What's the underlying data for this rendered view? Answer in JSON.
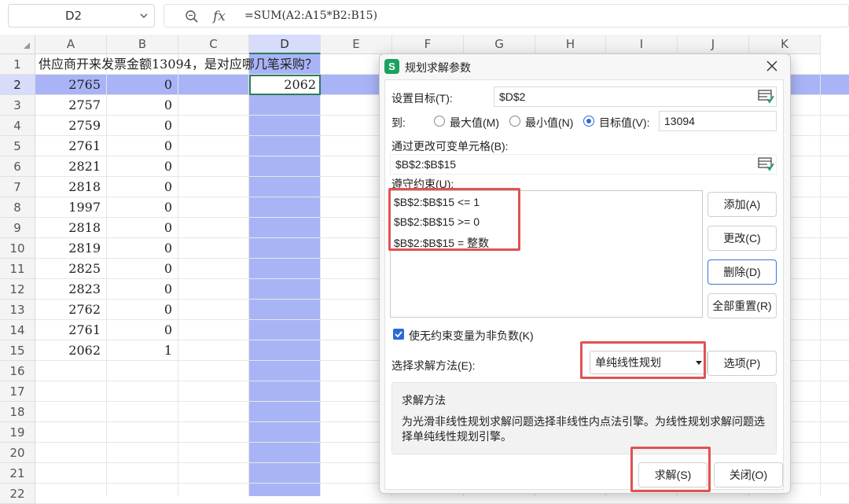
{
  "formula_bar": {
    "name_box": "D2",
    "zoom_icon": "zoom-icon",
    "fx_icon": "fx",
    "formula": "=SUM(A2:A15*B2:B15)"
  },
  "grid": {
    "columns": [
      "A",
      "B",
      "C",
      "D",
      "E",
      "F",
      "G",
      "H",
      "I",
      "J",
      "K"
    ],
    "selected_column": "D",
    "rows": [
      "1",
      "2",
      "3",
      "4",
      "5",
      "6",
      "7",
      "8",
      "9",
      "10",
      "11",
      "12",
      "13",
      "14",
      "15",
      "16",
      "17",
      "18",
      "19",
      "20",
      "21",
      "22"
    ],
    "selected_row": "2",
    "title_text": "供应商开来发票金额13094，是对应哪几笔采购？",
    "col_a": [
      "2765",
      "2757",
      "2759",
      "2761",
      "2821",
      "2818",
      "1997",
      "2818",
      "2819",
      "2825",
      "2823",
      "2762",
      "2761",
      "2062"
    ],
    "col_b": [
      "0",
      "0",
      "0",
      "0",
      "0",
      "0",
      "0",
      "0",
      "0",
      "0",
      "0",
      "0",
      "0",
      "1"
    ],
    "d2_value": "2062",
    "highlight_color": "#a9b4f7",
    "active_border_color": "#2b7d5a"
  },
  "dialog": {
    "title": "规划求解参数",
    "logo_letter": "S",
    "set_objective_label": "设置目标(T):",
    "set_objective_value": "$D$2",
    "to_label": "到:",
    "max_label": "最大值(M)",
    "min_label": "最小值(N)",
    "value_of_label": "目标值(V):",
    "value_of_value": "13094",
    "selected_goal": "目标值",
    "changing_cells_label": "通过更改可变单元格(B):",
    "changing_cells_value": "$B$2:$B$15",
    "constraints_label": "遵守约束(U):",
    "constraints": [
      "$B$2:$B$15 <= 1",
      "$B$2:$B$15 >= 0",
      "$B$2:$B$15 = 整数"
    ],
    "add_button": "添加(A)",
    "change_button": "更改(C)",
    "delete_button": "删除(D)",
    "reset_all_button": "全部重置(R)",
    "nonneg_checkbox_label": "使无约束变量为非负数(K)",
    "nonneg_checked": true,
    "method_label": "选择求解方法(E):",
    "method_value": "单纯线性规划",
    "options_button": "选项(P)",
    "desc_title": "求解方法",
    "desc_text": "为光滑非线性规划求解问题选择非线性内点法引擎。为线性规划求解问题选择单纯线性规划引擎。",
    "solve_button": "求解(S)",
    "close_button": "关闭(O)",
    "accent_color": "#2a6bd6",
    "annotation_color": "#e05252"
  }
}
